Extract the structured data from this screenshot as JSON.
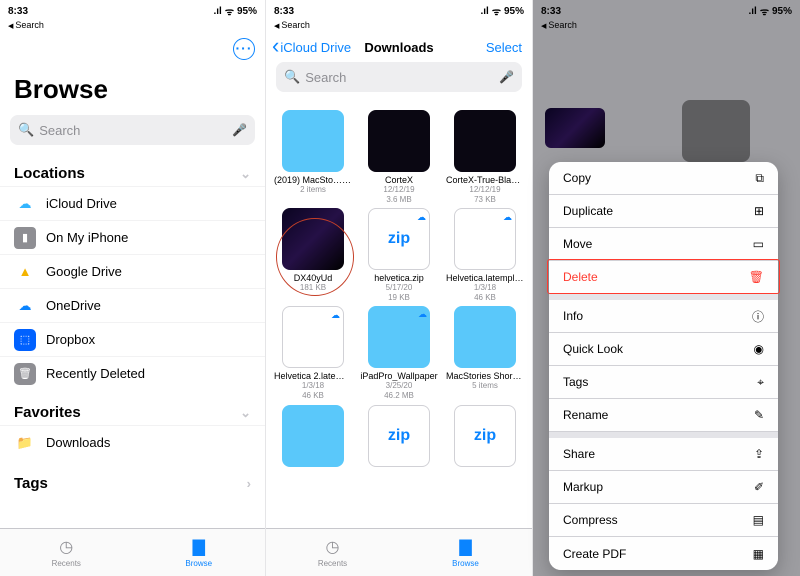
{
  "status": {
    "time": "8:33",
    "signal": "●●●●",
    "battery": "95%"
  },
  "breadcrumb": "Search",
  "panel1": {
    "title": "Browse",
    "search_placeholder": "Search",
    "locations_label": "Locations",
    "locations": [
      {
        "label": "iCloud Drive"
      },
      {
        "label": "On My iPhone"
      },
      {
        "label": "Google Drive"
      },
      {
        "label": "OneDrive"
      },
      {
        "label": "Dropbox"
      },
      {
        "label": "Recently Deleted"
      }
    ],
    "favorites_label": "Favorites",
    "favorites": [
      {
        "label": "Downloads"
      }
    ],
    "tags_label": "Tags",
    "tabs": {
      "recents": "Recents",
      "browse": "Browse"
    }
  },
  "panel2": {
    "back": "iCloud Drive",
    "title": "Downloads",
    "select": "Select",
    "search_placeholder": "Search",
    "files": [
      {
        "name": "(2019) MacSto…llpapers",
        "meta": "2 items",
        "kind": "folder"
      },
      {
        "name": "CorteX",
        "meta": "12/12/19\n3.6 MB",
        "kind": "dark"
      },
      {
        "name": "CorteX-True-Black-Neon",
        "meta": "12/12/19\n73 KB",
        "kind": "dark"
      },
      {
        "name": "DX40yUd",
        "meta": "181 KB",
        "kind": "img"
      },
      {
        "name": "helvetica.zip",
        "meta": "5/17/20\n19 KB",
        "kind": "zip",
        "cloud": true
      },
      {
        "name": "Helvetica.latemplate",
        "meta": "1/3/18\n46 KB",
        "kind": "white",
        "cloud": true
      },
      {
        "name": "Helvetica 2.latemplate",
        "meta": "1/3/18\n46 KB",
        "kind": "white",
        "cloud": true
      },
      {
        "name": "iPadPro_Wallpaper",
        "meta": "3/25/20\n46.2 MB",
        "kind": "folder",
        "cloud": true
      },
      {
        "name": "MacStories Shortcuts Icons",
        "meta": "5 items",
        "kind": "folder"
      },
      {
        "name": " ",
        "meta": "",
        "kind": "folder"
      },
      {
        "name": " ",
        "meta": "",
        "kind": "zip"
      },
      {
        "name": " ",
        "meta": "",
        "kind": "zip"
      }
    ],
    "tabs": {
      "recents": "Recents",
      "browse": "Browse"
    }
  },
  "panel3": {
    "menu": {
      "copy": "Copy",
      "duplicate": "Duplicate",
      "move": "Move",
      "delete": "Delete",
      "info": "Info",
      "quicklook": "Quick Look",
      "tags": "Tags",
      "rename": "Rename",
      "share": "Share",
      "markup": "Markup",
      "compress": "Compress",
      "createpdf": "Create PDF"
    }
  }
}
